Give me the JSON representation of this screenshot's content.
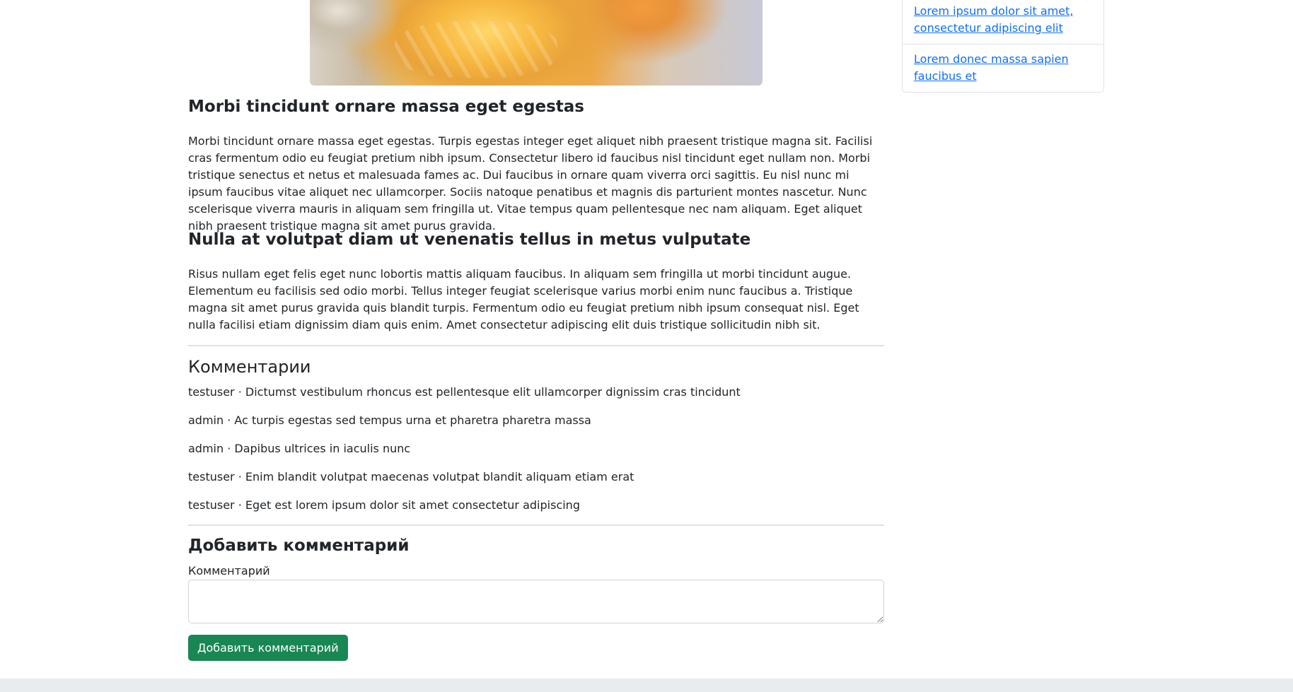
{
  "sidebar": {
    "links": [
      "Lorem ipsum dolor sit amet, consectetur adipiscing elit",
      "Lorem donec massa sapien faucibus et"
    ]
  },
  "article": {
    "sections": [
      {
        "heading": "Morbi tincidunt ornare massa eget egestas",
        "text": "Morbi tincidunt ornare massa eget egestas. Turpis egestas integer eget aliquet nibh praesent tristique magna sit. Facilisi cras fermentum odio eu feugiat pretium nibh ipsum. Consectetur libero id faucibus nisl tincidunt eget nullam non. Morbi tristique senectus et netus et malesuada fames ac. Dui faucibus in ornare quam viverra orci sagittis. Eu nisl nunc mi ipsum faucibus vitae aliquet nec ullamcorper. Sociis natoque penatibus et magnis dis parturient montes nascetur. Nunc scelerisque viverra mauris in aliquam sem fringilla ut. Vitae tempus quam pellentesque nec nam aliquam. Eget aliquet nibh praesent tristique magna sit amet purus gravida."
      },
      {
        "heading": "Nulla at volutpat diam ut venenatis tellus in metus vulputate",
        "text": "Risus nullam eget felis eget nunc lobortis mattis aliquam faucibus. In aliquam sem fringilla ut morbi tincidunt augue. Elementum eu facilisis sed odio morbi. Tellus integer feugiat scelerisque varius morbi enim nunc faucibus a. Tristique magna sit amet purus gravida quis blandit turpis. Fermentum odio eu feugiat pretium nibh ipsum consequat nisl. Eget nulla facilisi etiam dignissim diam quis enim. Amet consectetur adipiscing elit duis tristique sollicitudin nibh sit."
      }
    ]
  },
  "comments": {
    "title": "Комментарии",
    "items": [
      "testuser · Dictumst vestibulum rhoncus est pellentesque elit ullamcorper dignissim cras tincidunt",
      "admin · Ac turpis egestas sed tempus urna et pharetra pharetra massa",
      "admin · Dapibus ultrices in iaculis nunc",
      "testuser · Enim blandit volutpat maecenas volutpat blandit aliquam etiam erat",
      "testuser · Eget est lorem ipsum dolor sit amet consectetur adipiscing"
    ]
  },
  "add_comment": {
    "title": "Добавить комментарий",
    "field_label": "Комментарий",
    "field_value": "",
    "submit_label": "Добавить комментарий"
  },
  "colors": {
    "link": "#0d6efd",
    "submit_button": "#198754",
    "footer": "#e9ecef"
  }
}
